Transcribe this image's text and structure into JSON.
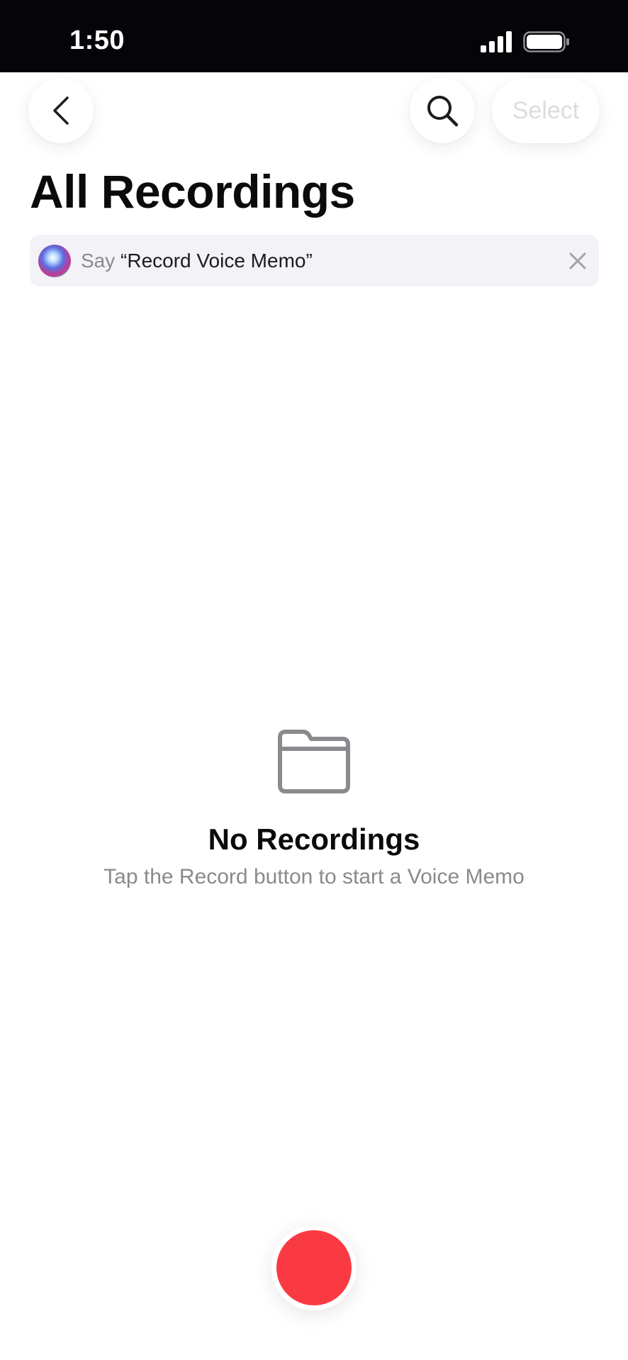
{
  "status_bar": {
    "time": "1:50"
  },
  "nav": {
    "select_label": "Select"
  },
  "header": {
    "title": "All Recordings"
  },
  "siri_banner": {
    "prefix": "Say ",
    "phrase": "“Record Voice Memo”"
  },
  "empty_state": {
    "title": "No Recordings",
    "subtitle": "Tap the Record button to start a Voice Memo"
  },
  "colors": {
    "record": "#fa3a42",
    "status_bar_bg": "#050409",
    "banner_bg": "#f2f2f7",
    "secondary_text": "#8a8a8e"
  },
  "icons": {
    "back": "chevron-left-icon",
    "search": "magnifier-icon",
    "close": "x-icon",
    "folder": "folder-icon",
    "signal": "cellular-signal-icon",
    "battery": "battery-icon",
    "siri": "siri-orb-icon"
  }
}
